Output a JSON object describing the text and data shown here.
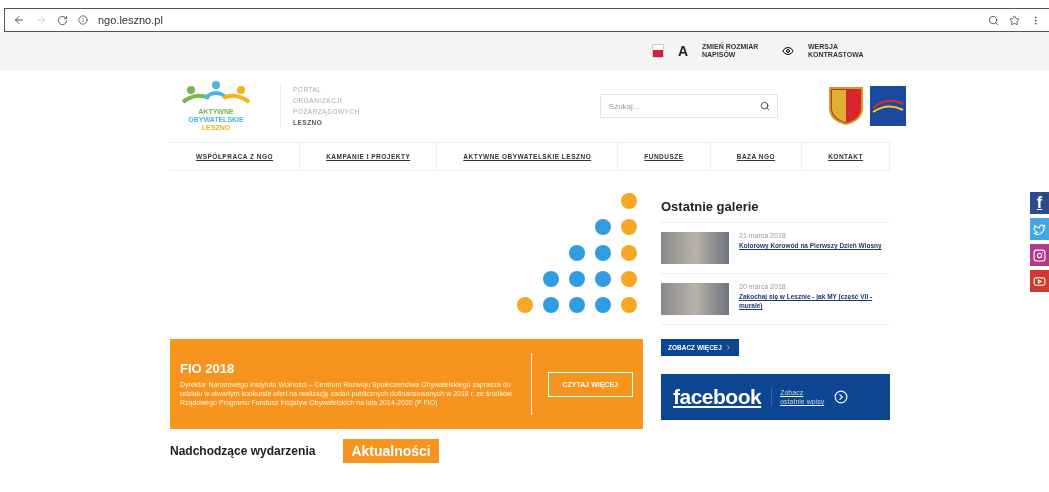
{
  "browser": {
    "url": "ngo.leszno.pl"
  },
  "utility_bar": {
    "font_size_label": "ZMIEŃ ROZMIAR NAPISÓW",
    "font_size_symbol": "A",
    "contrast_label": "WERSJA KONTRASTOWA"
  },
  "logo": {
    "line_1": "AKTYWNE",
    "line_2": "OBYWATELSKIE",
    "line_3": "LESZNO"
  },
  "portal_title": {
    "lines": [
      "PORTAL",
      "ORGANIZACJI",
      "POZARZĄDOWYCH"
    ],
    "city": "LESZNO"
  },
  "search": {
    "placeholder": "Szukaj..."
  },
  "nav": [
    {
      "label": "WSPÓŁPRACA Z NGO"
    },
    {
      "label": "KAMPANIE I PROJEKTY"
    },
    {
      "label": "AKTYWNE OBYWATELSKIE LESZNO"
    },
    {
      "label": "FUNDUSZE"
    },
    {
      "label": "BAZA NGO"
    },
    {
      "label": "KONTAKT"
    }
  ],
  "banner": {
    "title": "FIO 2018",
    "text": "Dyrektor Narodowego Instytutu Wolności – Centrum Rozwoju Społeczeństwa Obywatelskiego zaprasza do udziału w otwartym konkursie ofert na realizację zadań publicznych dofinansowanych w 2018 r. ze środków Rządowego Programu Fundusz Inicjatyw Obywatelskich na lata 2014-2020 (P FIO)",
    "button": "CZYTAJ WIĘCEJ"
  },
  "sections": {
    "events": "Nadchodzące wydarzenia",
    "news": "Aktualności"
  },
  "galleries": {
    "title": "Ostatnie galerie",
    "items": [
      {
        "date": "21 marca 2018",
        "title": "Kolorowy Korowód na Pierwszy Dzień Wiosny"
      },
      {
        "date": "20 marca 2018",
        "title": "Zakochaj się w Lesznie - jak MY (część VII - murale)"
      }
    ],
    "more": "ZOBACZ WIĘCEJ"
  },
  "facebook": {
    "brand": "facebook",
    "cta": "Zobacz ostatnie wpisy"
  },
  "social": [
    {
      "kind": "facebook",
      "label": "f"
    },
    {
      "kind": "twitter"
    },
    {
      "kind": "instagram"
    },
    {
      "kind": "youtube"
    }
  ]
}
